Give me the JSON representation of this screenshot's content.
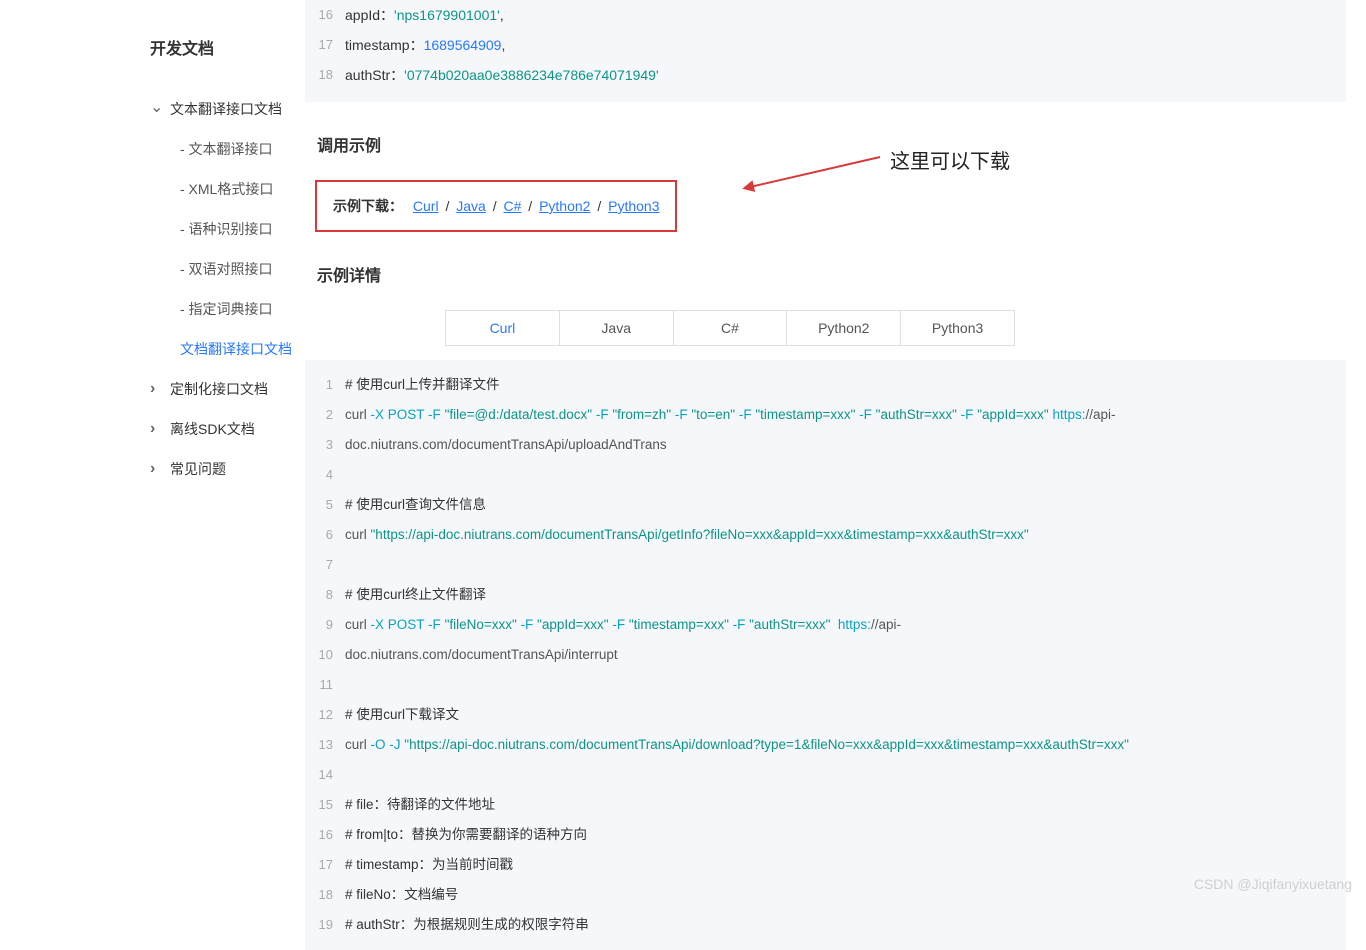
{
  "sidebar": {
    "title": "开发文档",
    "sections": [
      {
        "label": "文本翻译接口文档",
        "open": true,
        "children": [
          {
            "label": "- 文本翻译接口"
          },
          {
            "label": "- XML格式接口"
          },
          {
            "label": "- 语种识别接口"
          },
          {
            "label": "- 双语对照接口"
          },
          {
            "label": "- 指定词典接口"
          },
          {
            "label": "文档翻译接口文档",
            "active": true
          }
        ]
      },
      {
        "label": "定制化接口文档",
        "open": false
      },
      {
        "label": "离线SDK文档",
        "open": false
      },
      {
        "label": "常见问题",
        "open": false
      }
    ]
  },
  "topCode": {
    "lines": [
      {
        "no": 16,
        "tokens": [
          {
            "t": "appId：",
            "c": "tok-key"
          },
          {
            "t": "'nps1679901001'",
            "c": "tok-str"
          },
          {
            "t": ",",
            "c": "tok-key"
          }
        ]
      },
      {
        "no": 17,
        "tokens": [
          {
            "t": "timestamp：",
            "c": "tok-key"
          },
          {
            "t": "1689564909",
            "c": "tok-num"
          },
          {
            "t": ",",
            "c": "tok-key"
          }
        ]
      },
      {
        "no": 18,
        "tokens": [
          {
            "t": "authStr：",
            "c": "tok-key"
          },
          {
            "t": "'0774b020aa0e3886234e786e74071949'",
            "c": "tok-str"
          }
        ]
      }
    ]
  },
  "sections": {
    "callExample": "调用示例",
    "exampleDetail": "示例详情"
  },
  "download": {
    "label": "示例下载：",
    "links": [
      "Curl",
      "Java",
      "C#",
      "Python2",
      "Python3"
    ],
    "sep": " / "
  },
  "annotation": "这里可以下载",
  "tabs": [
    "Curl",
    "Java",
    "C#",
    "Python2",
    "Python3"
  ],
  "activeTab": 0,
  "mainCode": {
    "lines": [
      {
        "no": 1,
        "tokens": [
          {
            "t": "# 使用curl上传并翻译文件",
            "c": "tok-cmt"
          }
        ]
      },
      {
        "no": 2,
        "tokens": [
          {
            "t": "curl ",
            "c": "tok-plain"
          },
          {
            "t": "-X POST",
            "c": "tok-opt"
          },
          {
            "t": " ",
            "c": "tok-plain"
          },
          {
            "t": "-F",
            "c": "tok-opt"
          },
          {
            "t": " ",
            "c": "tok-plain"
          },
          {
            "t": "\"file=@d:/data/test.docx\"",
            "c": "tok-qstr"
          },
          {
            "t": " ",
            "c": "tok-plain"
          },
          {
            "t": "-F",
            "c": "tok-opt"
          },
          {
            "t": " ",
            "c": "tok-plain"
          },
          {
            "t": "\"from=zh\"",
            "c": "tok-qstr"
          },
          {
            "t": " ",
            "c": "tok-plain"
          },
          {
            "t": "-F",
            "c": "tok-opt"
          },
          {
            "t": " ",
            "c": "tok-plain"
          },
          {
            "t": "\"to=en\"",
            "c": "tok-qstr"
          },
          {
            "t": " ",
            "c": "tok-plain"
          },
          {
            "t": "-F",
            "c": "tok-opt"
          },
          {
            "t": " ",
            "c": "tok-plain"
          },
          {
            "t": "\"timestamp=xxx\"",
            "c": "tok-qstr"
          },
          {
            "t": " ",
            "c": "tok-plain"
          },
          {
            "t": "-F",
            "c": "tok-opt"
          },
          {
            "t": " ",
            "c": "tok-plain"
          },
          {
            "t": "\"authStr=xxx\"",
            "c": "tok-qstr"
          },
          {
            "t": " ",
            "c": "tok-plain"
          },
          {
            "t": "-F",
            "c": "tok-opt"
          },
          {
            "t": " ",
            "c": "tok-plain"
          },
          {
            "t": "\"appId=xxx\"",
            "c": "tok-qstr"
          },
          {
            "t": " ",
            "c": "tok-plain"
          },
          {
            "t": "https:",
            "c": "tok-opt"
          },
          {
            "t": "//api-",
            "c": "tok-plain"
          }
        ]
      },
      {
        "no": 3,
        "tokens": [
          {
            "t": "doc.niutrans.com/documentTransApi/uploadAndTrans",
            "c": "tok-plain"
          }
        ]
      },
      {
        "no": 4,
        "tokens": [
          {
            "t": "",
            "c": "tok-plain"
          }
        ]
      },
      {
        "no": 5,
        "tokens": [
          {
            "t": "# 使用curl查询文件信息",
            "c": "tok-cmt"
          }
        ]
      },
      {
        "no": 6,
        "tokens": [
          {
            "t": "curl ",
            "c": "tok-plain"
          },
          {
            "t": "\"https://api-doc.niutrans.com/documentTransApi/getInfo?fileNo=xxx&appId=xxx&timestamp=xxx&authStr=xxx\"",
            "c": "tok-qstr"
          }
        ]
      },
      {
        "no": 7,
        "tokens": [
          {
            "t": "",
            "c": "tok-plain"
          }
        ]
      },
      {
        "no": 8,
        "tokens": [
          {
            "t": "# 使用curl终止文件翻译",
            "c": "tok-cmt"
          }
        ]
      },
      {
        "no": 9,
        "tokens": [
          {
            "t": "curl ",
            "c": "tok-plain"
          },
          {
            "t": "-X POST",
            "c": "tok-opt"
          },
          {
            "t": " ",
            "c": "tok-plain"
          },
          {
            "t": "-F",
            "c": "tok-opt"
          },
          {
            "t": " ",
            "c": "tok-plain"
          },
          {
            "t": "\"fileNo=xxx\"",
            "c": "tok-qstr"
          },
          {
            "t": " ",
            "c": "tok-plain"
          },
          {
            "t": "-F",
            "c": "tok-opt"
          },
          {
            "t": " ",
            "c": "tok-plain"
          },
          {
            "t": "\"appId=xxx\"",
            "c": "tok-qstr"
          },
          {
            "t": " ",
            "c": "tok-plain"
          },
          {
            "t": "-F",
            "c": "tok-opt"
          },
          {
            "t": " ",
            "c": "tok-plain"
          },
          {
            "t": "\"timestamp=xxx\"",
            "c": "tok-qstr"
          },
          {
            "t": " ",
            "c": "tok-plain"
          },
          {
            "t": "-F",
            "c": "tok-opt"
          },
          {
            "t": " ",
            "c": "tok-plain"
          },
          {
            "t": "\"authStr=xxx\"",
            "c": "tok-qstr"
          },
          {
            "t": "  ",
            "c": "tok-plain"
          },
          {
            "t": "https:",
            "c": "tok-opt"
          },
          {
            "t": "//api-",
            "c": "tok-plain"
          }
        ]
      },
      {
        "no": 10,
        "tokens": [
          {
            "t": "doc.niutrans.com/documentTransApi/interrupt",
            "c": "tok-plain"
          }
        ]
      },
      {
        "no": 11,
        "tokens": [
          {
            "t": "",
            "c": "tok-plain"
          }
        ]
      },
      {
        "no": 12,
        "tokens": [
          {
            "t": "# 使用curl下载译文",
            "c": "tok-cmt"
          }
        ]
      },
      {
        "no": 13,
        "tokens": [
          {
            "t": "curl ",
            "c": "tok-plain"
          },
          {
            "t": "-O",
            "c": "tok-opt"
          },
          {
            "t": " ",
            "c": "tok-plain"
          },
          {
            "t": "-J",
            "c": "tok-opt"
          },
          {
            "t": " ",
            "c": "tok-plain"
          },
          {
            "t": "\"https://api-doc.niutrans.com/documentTransApi/download?type=1&fileNo=xxx&appId=xxx&timestamp=xxx&authStr=xxx\"",
            "c": "tok-qstr"
          }
        ]
      },
      {
        "no": 14,
        "tokens": [
          {
            "t": "",
            "c": "tok-plain"
          }
        ]
      },
      {
        "no": 15,
        "tokens": [
          {
            "t": "# file：待翻译的文件地址",
            "c": "tok-cmt"
          }
        ]
      },
      {
        "no": 16,
        "tokens": [
          {
            "t": "# from|to：替换为你需要翻译的语种方向",
            "c": "tok-cmt"
          }
        ]
      },
      {
        "no": 17,
        "tokens": [
          {
            "t": "# timestamp：为当前时间戳",
            "c": "tok-cmt"
          }
        ]
      },
      {
        "no": 18,
        "tokens": [
          {
            "t": "# fileNo：文档编号",
            "c": "tok-cmt"
          }
        ]
      },
      {
        "no": 19,
        "tokens": [
          {
            "t": "# authStr：为根据规则生成的权限字符串",
            "c": "tok-cmt"
          }
        ]
      }
    ]
  },
  "watermark": "CSDN @Jiqifanyixuetang"
}
